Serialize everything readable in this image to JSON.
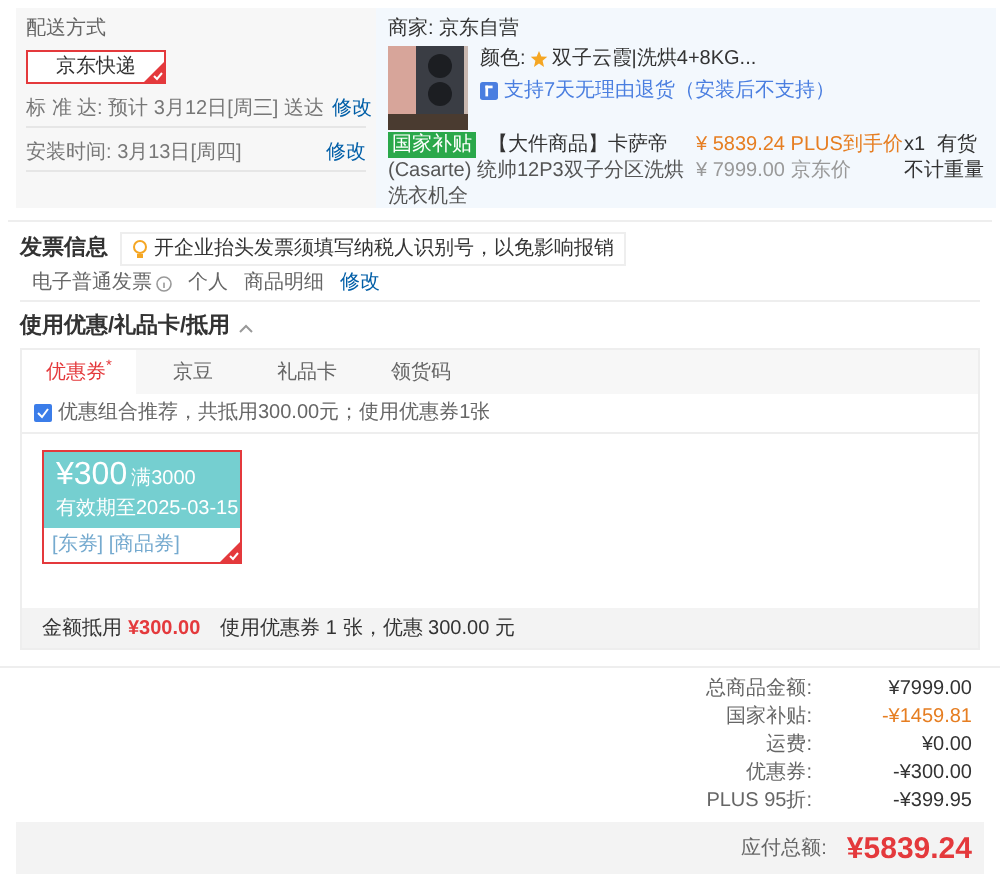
{
  "shipping": {
    "title": "配送方式",
    "options": [
      {
        "label": "京东快递",
        "selected": true
      }
    ],
    "rows": [
      {
        "label": "标 准 达:",
        "value": "预计 3月12日[周三] 送达",
        "action": "修改"
      },
      {
        "label": "安装时间:",
        "value": "3月13日[周四]",
        "action": "修改"
      }
    ]
  },
  "product": {
    "seller": "商家: 京东自营",
    "color_label": "颜色:",
    "color_value": "双子云霞|洗烘4+8KG...",
    "service": "支持7天无理由退货（安装后不支持）",
    "badge": "国家补贴",
    "title_line1": "【大件商品】卡萨帝",
    "title_line2": "(Casarte) 统帅12P3双子分区洗烘洗衣机全",
    "price": "¥ 5839.24",
    "price_label": "PLUS到手价",
    "orig_price": "¥ 7999.00",
    "orig_label": "京东价",
    "qty": "x1",
    "weight": "不计重量",
    "stock": "有货"
  },
  "invoice": {
    "title": "发票信息",
    "tip": "开企业抬头发票须填写纳税人识别号，以免影响报销",
    "type": "电子普通发票",
    "person": "个人",
    "content": "商品明细",
    "action": "修改"
  },
  "discounts": {
    "title": "使用优惠/礼品卡/抵用",
    "expanded": true,
    "tabs": [
      {
        "label": "优惠券",
        "marker": "*",
        "selected": true
      },
      {
        "label": "京豆",
        "selected": false
      },
      {
        "label": "礼品卡",
        "selected": false
      },
      {
        "label": "领货码",
        "selected": false
      }
    ],
    "recommend": {
      "label": "优惠组合推荐，共抵用300.00元；使用优惠券1张",
      "checked": true
    },
    "coupons": [
      {
        "amount": "¥300",
        "condition": "满3000",
        "expiry": "有效期至2025-03-15",
        "tags": "[东券] [商品券]",
        "selected": true
      }
    ],
    "footer_label": "金额抵用",
    "footer_amount": "¥300.00",
    "footer_note": "使用优惠券 1 张，优惠 300.00 元"
  },
  "summary": {
    "rows": [
      {
        "label": "总商品金额:",
        "value": "¥7999.00",
        "color": "#333333"
      },
      {
        "label": "国家补贴:",
        "value": "-¥1459.81",
        "color": "#e67e22"
      },
      {
        "label": "运费:",
        "value": "¥0.00",
        "color": "#333333"
      },
      {
        "label": "优惠券:",
        "value": "-¥300.00",
        "color": "#333333"
      },
      {
        "label": "PLUS 95折:",
        "value": "-¥399.95",
        "color": "#333333"
      }
    ],
    "total_label": "应付总额:",
    "total": "¥5839.24"
  }
}
